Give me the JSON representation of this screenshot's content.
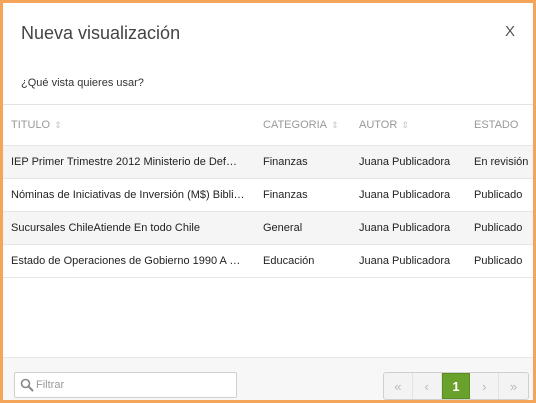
{
  "dialog": {
    "title": "Nueva visualización",
    "close_label": "X",
    "subtitle": "¿Qué vista quieres usar?"
  },
  "table": {
    "headers": [
      {
        "label": "TITULO",
        "sortable": true
      },
      {
        "label": "CATEGORIA",
        "sortable": true
      },
      {
        "label": "AUTOR",
        "sortable": true
      },
      {
        "label": "ESTADO",
        "sortable": false
      }
    ],
    "rows": [
      {
        "title": "IEP Primer Trimestre 2012 Ministerio de Def…",
        "category": "Finanzas",
        "author": "Juana Publicadora",
        "status": "En revisión"
      },
      {
        "title": "Nóminas de Iniciativas de Inversión (M$) Bibli…",
        "category": "Finanzas",
        "author": "Juana Publicadora",
        "status": "Publicado"
      },
      {
        "title": "Sucursales ChileAtiende En todo Chile",
        "category": "General",
        "author": "Juana Publicadora",
        "status": "Publicado"
      },
      {
        "title": "Estado de Operaciones de Gobierno 1990 A …",
        "category": "Educación",
        "author": "Juana Publicadora",
        "status": "Publicado"
      }
    ]
  },
  "footer": {
    "filter_placeholder": "Filtrar",
    "filter_value": "",
    "pagination": {
      "first_icon": "double-chevron-left-icon",
      "prev_icon": "chevron-left-icon",
      "current_page": "1",
      "next_icon": "chevron-right-icon",
      "last_icon": "double-chevron-right-icon"
    }
  },
  "colors": {
    "border_accent": "#f5a55a",
    "active_page": "#6aa12c"
  }
}
